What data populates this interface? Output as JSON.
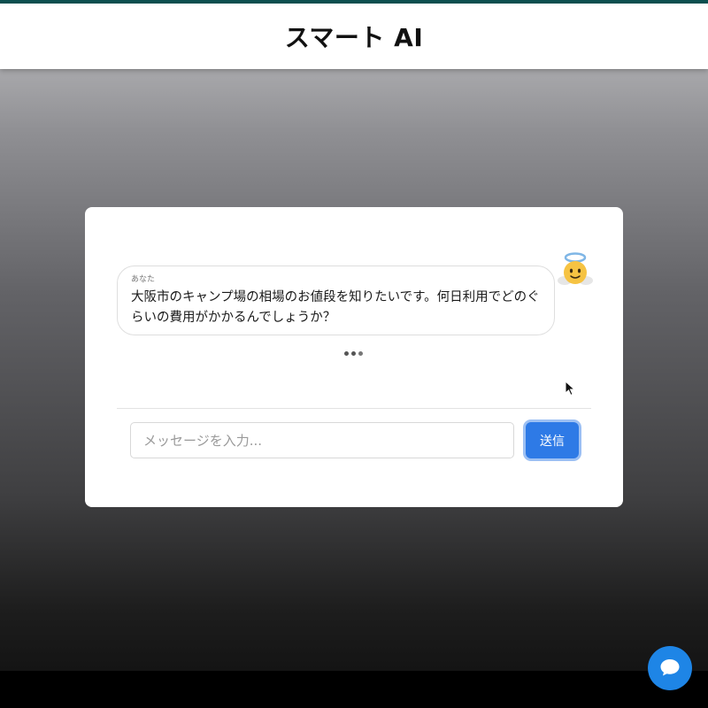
{
  "header": {
    "title": "スマート AI"
  },
  "chat": {
    "messages": [
      {
        "sender_label": "あなた",
        "text": "大阪市のキャンプ場の相場のお値段を知りたいです。何日利用でどのぐらいの費用がかかるんでしょうか？",
        "avatar_icon": "angel-face-icon"
      }
    ],
    "typing_indicator": "typing-dots"
  },
  "composer": {
    "placeholder": "メッセージを入力...",
    "value": "",
    "send_label": "送信"
  },
  "fab": {
    "icon": "chat-bubble-icon"
  },
  "colors": {
    "header_accent": "#0c4f4f",
    "send_button": "#2e7ae6",
    "fab": "#1e85e6"
  }
}
